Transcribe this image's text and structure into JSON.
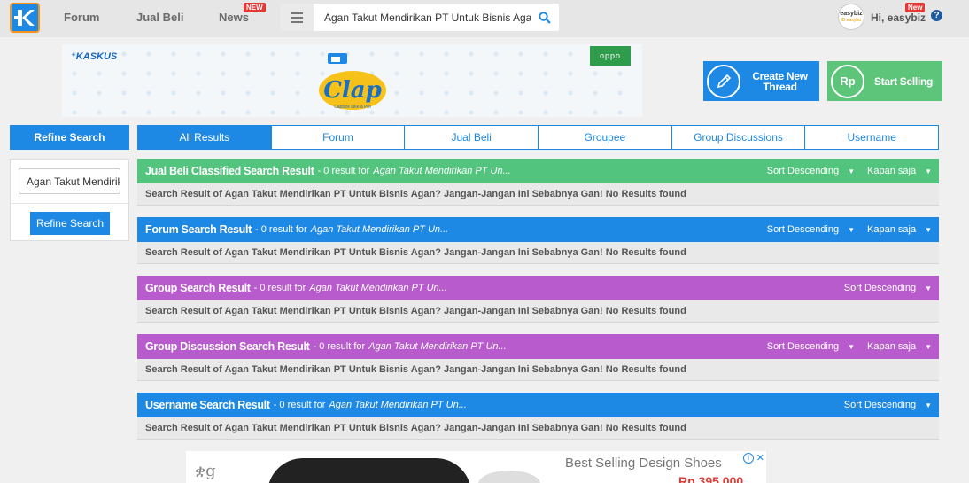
{
  "nav": {
    "forum": "Forum",
    "jual_beli": "Jual Beli",
    "news": "News",
    "news_badge": "NEW",
    "search_value": "Agan Takut Mendirikan PT Untuk Bisnis Agan? Jangan-Jangan Ini Sebabnya Gan!",
    "avatar_line1": "easybiz",
    "avatar_line2": "ID.easybiz",
    "greeting": "Hi, easybiz",
    "user_badge": "New",
    "help": "?"
  },
  "banner": {
    "kaskus": "⁺KASKUS",
    "oppo": "oppo",
    "clap": "Clap",
    "clap_sub": "Capture Like a Pro"
  },
  "cta": {
    "create_thread": "Create New Thread",
    "start_selling": "Start Selling",
    "rp_icon": "Rp"
  },
  "refine": {
    "heading": "Refine Search",
    "input_value": "Agan Takut Mendirikan PT Untuk Bisnis Agan?",
    "button": "Refine Search"
  },
  "tabs": [
    "All Results",
    "Forum",
    "Jual Beli",
    "Groupee",
    "Group Discussions",
    "Username"
  ],
  "sections": [
    {
      "title": "Jual Beli Classified Search Result",
      "count": "- 0 result for",
      "query": "Agan Takut Mendirikan PT Un...",
      "sort": "Sort Descending",
      "time": "Kapan saja",
      "body": "Search Result of Agan Takut Mendirikan PT Untuk Bisnis Agan? Jangan-Jangan Ini Sebabnya Gan! No Results found",
      "color": "#52c47e"
    },
    {
      "title": "Forum Search Result",
      "count": "- 0 result for",
      "query": "Agan Takut Mendirikan PT Un...",
      "sort": "Sort Descending",
      "time": "Kapan saja",
      "body": "Search Result of Agan Takut Mendirikan PT Untuk Bisnis Agan? Jangan-Jangan Ini Sebabnya Gan! No Results found",
      "color": "#1e88e5"
    },
    {
      "title": "Group Search Result",
      "count": "- 0 result for",
      "query": "Agan Takut Mendirikan PT Un...",
      "sort": "Sort Descending",
      "body": "Search Result of Agan Takut Mendirikan PT Untuk Bisnis Agan? Jangan-Jangan Ini Sebabnya Gan! No Results found",
      "color": "#b85ccd"
    },
    {
      "title": "Group Discussion Search Result",
      "count": "- 0 result for",
      "query": "Agan Takut Mendirikan PT Un...",
      "sort": "Sort Descending",
      "time": "Kapan saja",
      "body": "Search Result of Agan Takut Mendirikan PT Untuk Bisnis Agan? Jangan-Jangan Ini Sebabnya Gan! No Results found",
      "color": "#b85ccd"
    },
    {
      "title": "Username Search Result",
      "count": "- 0 result for",
      "query": "Agan Takut Mendirikan PT Un...",
      "sort": "Sort Descending",
      "body": "Search Result of Agan Takut Mendirikan PT Untuk Bisnis Agan? Jangan-Jangan Ini Sebabnya Gan! No Results found",
      "color": "#1e88e5"
    }
  ],
  "ad": {
    "headline": "Best Selling Design Shoes",
    "price": "Rp 395.000",
    "info": "i",
    "close": "✕",
    "logo": "ቋg"
  },
  "colors": {
    "primary": "#1e88e5",
    "green": "#52c47e",
    "purple": "#b85ccd",
    "logo_border": "#f7941d"
  }
}
